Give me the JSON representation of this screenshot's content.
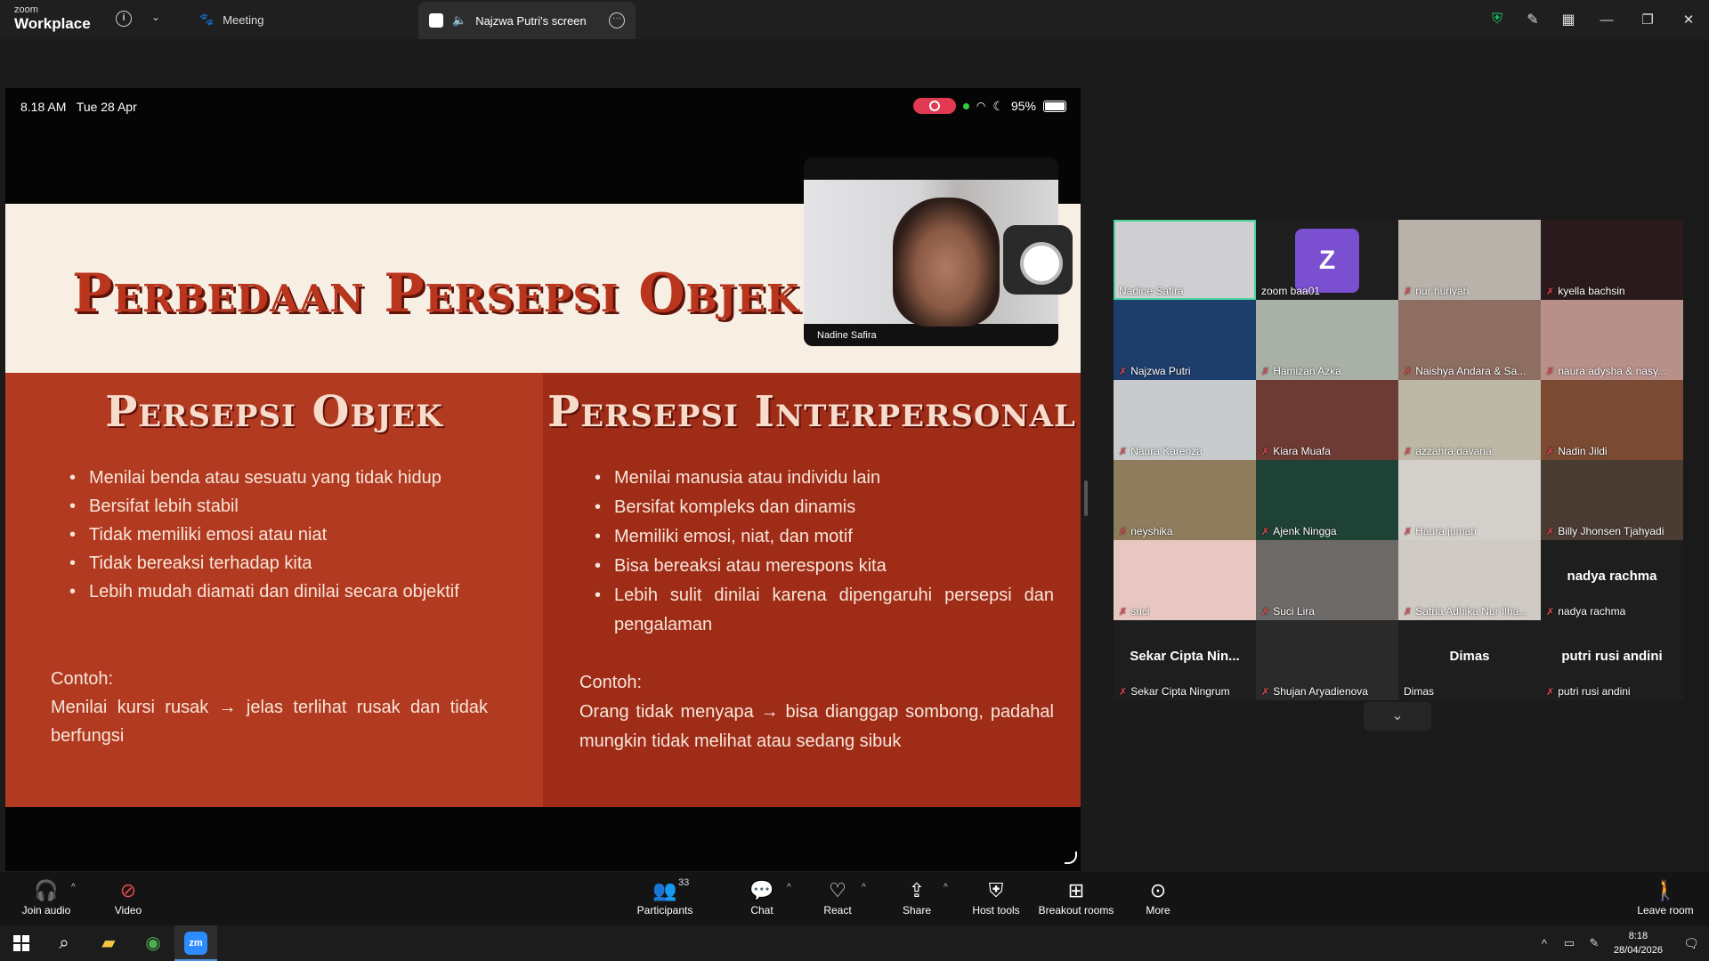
{
  "titlebar": {
    "brand_top": "zoom",
    "brand_bottom": "Workplace",
    "info_glyph": "i",
    "chevron_glyph": "⌄",
    "meeting_tab": "Meeting",
    "screen_tab": "Najzwa Putri's screen",
    "icons": [
      "shield-check-icon",
      "pencil-icon",
      "layout-icon"
    ],
    "window_controls": [
      "—",
      "❐",
      "✕"
    ]
  },
  "ipad_status": {
    "time": "8.18 AM   Tue 28 Apr",
    "battery": "95%"
  },
  "slide": {
    "title": "Perbedaan Persepsi Objek & Inter",
    "left": {
      "heading": "Persepsi Objek",
      "bullets": [
        "Menilai benda atau sesuatu yang tidak hidup",
        "Bersifat lebih stabil",
        "Tidak memiliki emosi atau niat",
        "Tidak bereaksi terhadap kita",
        "Lebih mudah diamati dan dinilai secara objektif"
      ],
      "example_label": "Contoh:",
      "example_text": "Menilai kursi rusak → jelas terlihat rusak dan tidak berfungsi"
    },
    "right": {
      "heading": "Persepsi Interpersonal",
      "bullets": [
        "Menilai manusia atau individu lain",
        "Bersifat kompleks dan dinamis",
        "Memiliki emosi, niat, dan motif",
        "Bisa bereaksi atau merespons kita",
        "Lebih sulit dinilai karena dipengaruhi persepsi dan pengalaman"
      ],
      "example_label": "Contoh:",
      "example_text": "Orang tidak menyapa → bisa dianggap sombong, padahal mungkin tidak melihat atau sedang sibuk"
    }
  },
  "pip": {
    "name": "Nadine Safira"
  },
  "participants": [
    {
      "name": "Nadine Safira",
      "muted": false,
      "active": true,
      "bg": "#cfcfd2"
    },
    {
      "name": "zoom baa01",
      "muted": false,
      "avatar": "Z",
      "bg": "#1e1e1e"
    },
    {
      "name": "nur huriyah",
      "muted": true,
      "bg": "#b9b2ab"
    },
    {
      "name": "kyella bachsin",
      "muted": true,
      "bg": "#2a1a1c"
    },
    {
      "name": "Najzwa Putri",
      "muted": true,
      "bg": "#1d3d6b"
    },
    {
      "name": "Hamizan Azka",
      "muted": true,
      "bg": "#a9b0a5"
    },
    {
      "name": "Naishya Andara & Sa...",
      "muted": true,
      "bg": "#8f6e62"
    },
    {
      "name": "naura adysha & nasy...",
      "muted": true,
      "bg": "#b8908a"
    },
    {
      "name": "Naura Karenza",
      "muted": true,
      "bg": "#c7cbcd"
    },
    {
      "name": "Kiara Muafa",
      "muted": true,
      "bg": "#6e3a34"
    },
    {
      "name": "azzahra davana",
      "muted": true,
      "bg": "#bdb7a6"
    },
    {
      "name": "Nadin Jildi",
      "muted": true,
      "bg": "#7a4a33"
    },
    {
      "name": "neyshika",
      "muted": true,
      "bg": "#8f7c5c"
    },
    {
      "name": "Ajenk Ningga",
      "muted": true,
      "bg": "#1f4236"
    },
    {
      "name": "Haura juman",
      "muted": true,
      "bg": "#d3cfcb"
    },
    {
      "name": "Billy Jhonsen Tjahyadi",
      "muted": true,
      "bg": "#4a3b33"
    },
    {
      "name": "suci",
      "muted": true,
      "bg": "#e8c7c3"
    },
    {
      "name": "Suci Lira",
      "muted": true,
      "bg": "#6d6a68"
    },
    {
      "name": "Satria Adhika Nur Ilha...",
      "muted": true,
      "bg": "#cfcac4"
    },
    {
      "name": "nadya rachma",
      "muted": true,
      "bigname": "nadya rachma",
      "bg": "#1e1e1e"
    },
    {
      "name": "Sekar Cipta Ningrum",
      "muted": true,
      "bigname": "Sekar Cipta Nin...",
      "bg": "#1e1e1e"
    },
    {
      "name": "Shujan Aryadienova",
      "muted": true,
      "bg": "#2a2a2a"
    },
    {
      "name": "Dimas",
      "muted": false,
      "bigname": "Dimas",
      "bg": "#1e1e1e"
    },
    {
      "name": "putri rusi andini",
      "muted": true,
      "bigname": "putri rusi andini",
      "bg": "#1e1e1e"
    }
  ],
  "gallery_more": "⌄",
  "toolbar": {
    "join_audio": "Join audio",
    "video": "Video",
    "participants": "Participants",
    "participants_count": "33",
    "chat": "Chat",
    "react": "React",
    "share": "Share",
    "host_tools": "Host tools",
    "breakout_rooms": "Breakout rooms",
    "more": "More",
    "leave_room": "Leave room"
  },
  "taskbar": {
    "time": "8:18",
    "date": "28/04/2026",
    "zoom_label": "zm"
  }
}
